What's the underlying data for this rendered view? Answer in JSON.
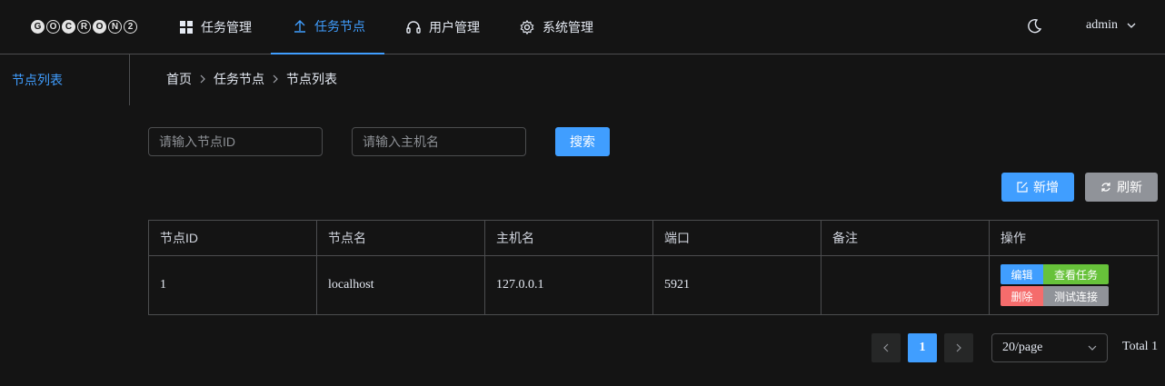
{
  "app": {
    "logo_letters": [
      "G",
      "O",
      "C",
      "R",
      "O",
      "N",
      "2"
    ]
  },
  "nav": {
    "items": [
      {
        "label": "任务管理",
        "icon": "grid-icon"
      },
      {
        "label": "任务节点",
        "icon": "upload-icon"
      },
      {
        "label": "用户管理",
        "icon": "headset-icon"
      },
      {
        "label": "系统管理",
        "icon": "gear-icon"
      }
    ],
    "active_index": 1
  },
  "user": {
    "name": "admin"
  },
  "sidebar": {
    "items": [
      {
        "label": "节点列表"
      }
    ]
  },
  "breadcrumb": [
    "首页",
    "任务节点",
    "节点列表"
  ],
  "search": {
    "node_id_placeholder": "请输入节点ID",
    "hostname_placeholder": "请输入主机名",
    "search_label": "搜索"
  },
  "toolbar": {
    "add_label": "新增",
    "refresh_label": "刷新"
  },
  "table": {
    "headers": [
      "节点ID",
      "节点名",
      "主机名",
      "端口",
      "备注",
      "操作"
    ],
    "rows": [
      {
        "id": "1",
        "name": "localhost",
        "host": "127.0.0.1",
        "port": "5921",
        "note": ""
      }
    ],
    "actions": {
      "edit": "编辑",
      "view": "查看任务",
      "delete": "删除",
      "test": "测试连接"
    }
  },
  "pagination": {
    "current_page": "1",
    "page_size": "20/page",
    "total": "Total 1"
  },
  "colors": {
    "accent": "#409eff",
    "success": "#67c23a",
    "danger": "#f56c6c",
    "info": "#909399",
    "background": "#141414"
  }
}
